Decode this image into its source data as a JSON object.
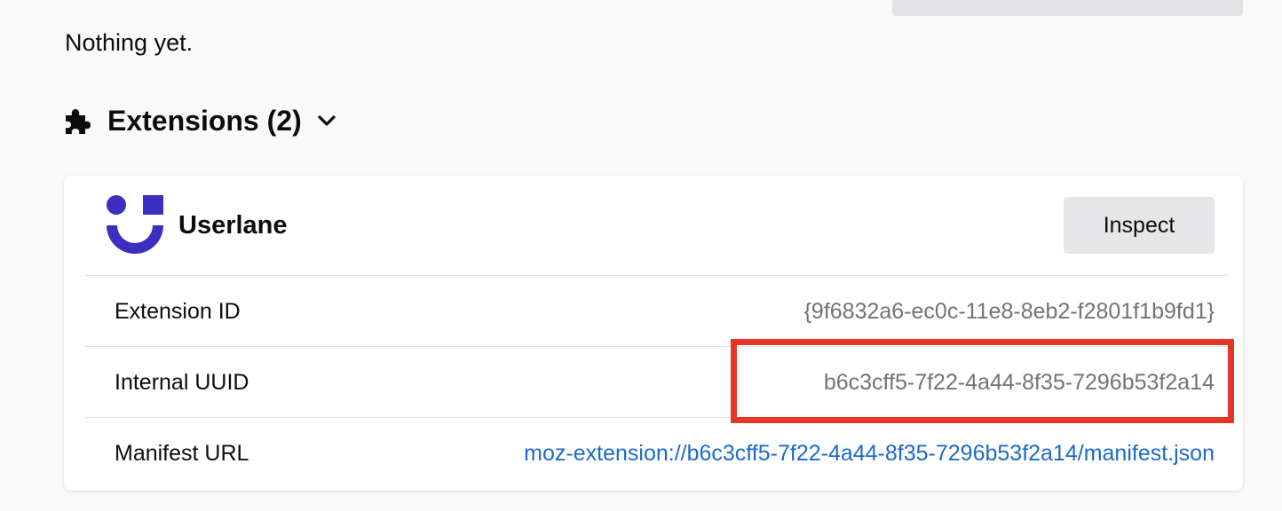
{
  "colors": {
    "background": "#f9f9fa",
    "card": "#ffffff",
    "brand_logo": "#3b2ec1",
    "link": "#1b6ac9",
    "muted_value": "#737373",
    "highlight": "#e4372a"
  },
  "empty_state": "Nothing yet.",
  "extensions": {
    "icon": "puzzle-icon",
    "heading": "Extensions (2)",
    "toggle_icon": "chevron-down-icon",
    "items": [
      {
        "name": "Userlane",
        "logo": "userlane-logo",
        "inspect_label": "Inspect",
        "fields": [
          {
            "label": "Extension ID",
            "value": "{9f6832a6-ec0c-11e8-8eb2-f2801f1b9fd1}"
          },
          {
            "label": "Internal UUID",
            "value": "b6c3cff5-7f22-4a44-8f35-7296b53f2a14"
          },
          {
            "label": "Manifest URL",
            "value": "moz-extension://b6c3cff5-7f22-4a44-8f35-7296b53f2a14/manifest.json"
          }
        ]
      }
    ]
  }
}
